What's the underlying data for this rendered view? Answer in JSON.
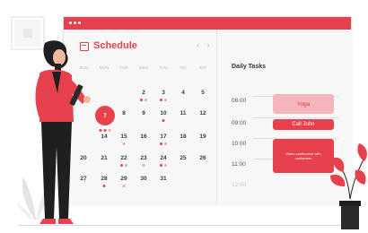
{
  "app": {
    "title": "Schedule"
  },
  "calendar": {
    "title": "Schedule",
    "nav": "‹ ›",
    "weekdays": [
      "SUN",
      "MON",
      "TUE",
      "WED",
      "THU",
      "FRI",
      "SAT"
    ],
    "weeks": [
      [
        "",
        "",
        "",
        "2",
        "3",
        "4",
        "5"
      ],
      [
        "",
        "7",
        "8",
        "9",
        "10",
        "11",
        "12"
      ],
      [
        "",
        "14",
        "15",
        "16",
        "17",
        "18",
        "19"
      ],
      [
        "20",
        "21",
        "22",
        "23",
        "24",
        "25",
        "26"
      ],
      [
        "27",
        "28",
        "29",
        "30",
        "31",
        "",
        ""
      ]
    ],
    "selected_day": "7"
  },
  "tasks": {
    "title": "Daily Tasks",
    "times": [
      "08:00",
      "09:00",
      "10:00",
      "11:00",
      "12:00"
    ],
    "items": [
      {
        "label": "Yoga"
      },
      {
        "label": "Call John"
      },
      {
        "label": "Video conference with customers"
      }
    ]
  },
  "colors": {
    "accent": "#e8414e",
    "accent_light": "#f5b6bb"
  }
}
